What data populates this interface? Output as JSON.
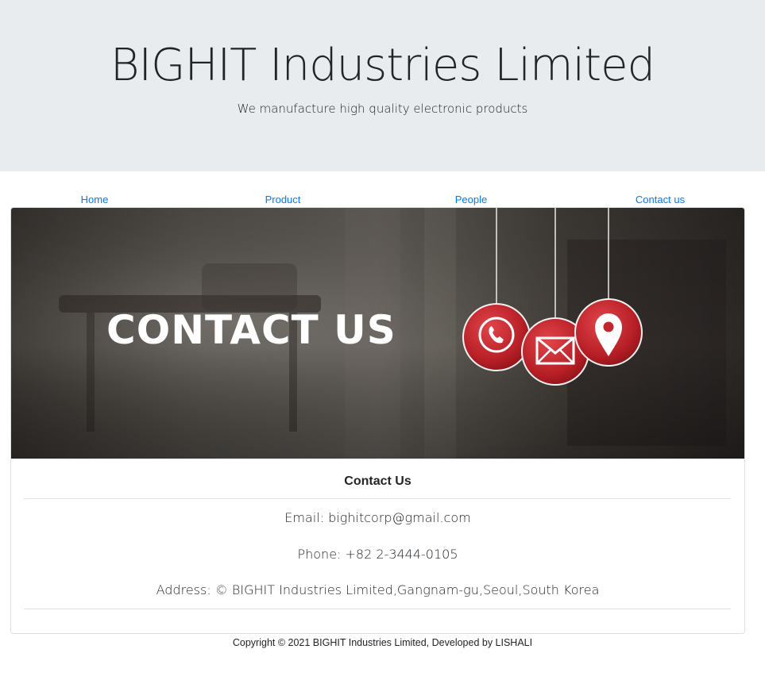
{
  "header": {
    "title": "BIGHIT Industries Limited",
    "tagline": "We manufacture high quality electronic products"
  },
  "nav": {
    "items": [
      {
        "label": "Home"
      },
      {
        "label": "Product"
      },
      {
        "label": "People"
      },
      {
        "label": "Contact us"
      }
    ]
  },
  "banner": {
    "text": "CONTACT US",
    "icons": [
      "phone-icon",
      "mail-icon",
      "location-pin-icon"
    ],
    "accent_color": "#c2272d"
  },
  "contact": {
    "heading": "Contact Us",
    "email": "Email: bighitcorp@gmail.com",
    "phone": "Phone: +82 2-3444-0105",
    "address": "Address: © BIGHIT Industries Limited,Gangnam-gu,Seoul,South Korea"
  },
  "footer": {
    "copyright": "Copyright © 2021 BIGHIT Industries Limited, Developed by LISHALI"
  },
  "colors": {
    "jumbotron_bg": "#e9ecef",
    "link": "#007bff"
  }
}
